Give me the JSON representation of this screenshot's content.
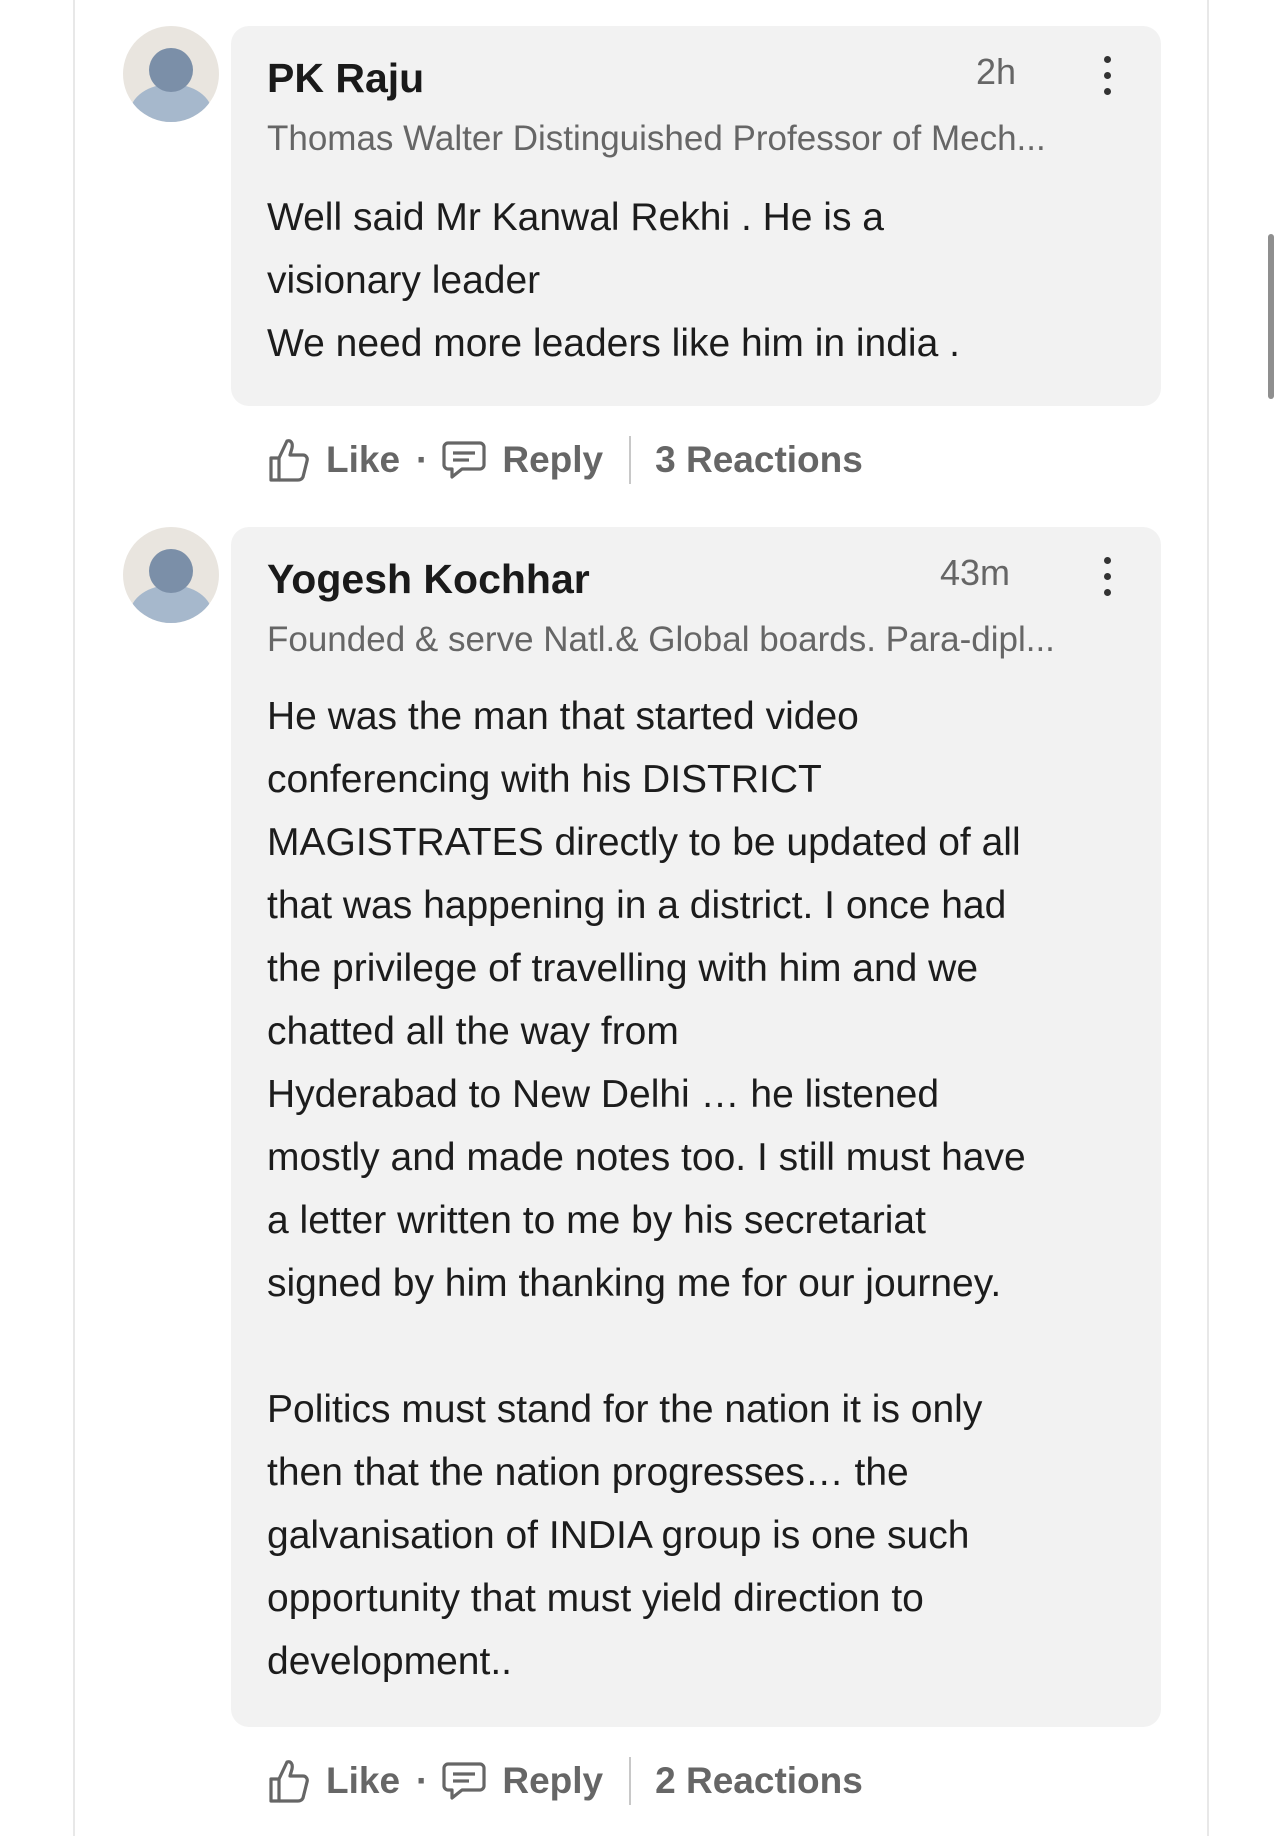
{
  "comments": [
    {
      "author": "PK Raju",
      "time": "2h",
      "headline": "Thomas Walter Distinguished Professor of Mech...",
      "text": "Well said Mr Kanwal  Rekhi . He is a\nvisionary leader\nWe need more leaders like him in india .",
      "actions": {
        "like": "Like",
        "reply": "Reply",
        "reactions": "3 Reactions"
      }
    },
    {
      "author": "Yogesh Kochhar",
      "time": "43m",
      "headline": "Founded & serve Natl.& Global boards. Para-dipl...",
      "text": "He was the man that started video\nconferencing with his DISTRICT\nMAGISTRATES directly to be updated of all\nthat was happening in a district. I once had\nthe privilege of travelling with him and we\nchatted all the way from\nHyderabad to New Delhi … he listened\nmostly and made notes too. I still must have\na letter written to me by his secretariat\nsigned by him thanking me for our journey.\n\nPolitics must stand for the nation it is only\nthen that the nation progresses… the\ngalvanisation of INDIA group is one such\nopportunity that must yield direction to\ndevelopment..",
      "actions": {
        "like": "Like",
        "reply": "Reply",
        "reactions": "2 Reactions"
      }
    }
  ],
  "icons": {
    "like": "thumbs-up-icon",
    "reply": "speech-bubble-icon",
    "menu": "more-vertical-icon",
    "avatar": "default-person-avatar"
  }
}
